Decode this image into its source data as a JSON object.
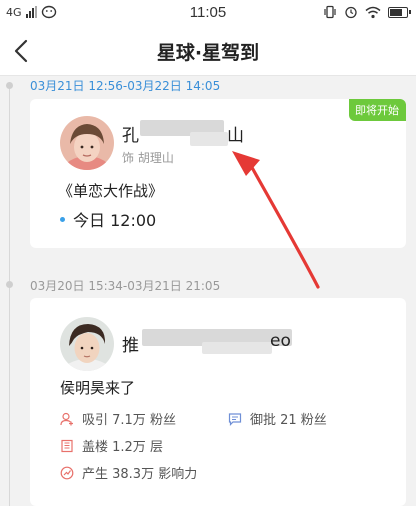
{
  "statusbar": {
    "network": "4G",
    "time": "11:05"
  },
  "navbar": {
    "title": "星球·星驾到"
  },
  "events": [
    {
      "daterange": "03月21日 12:56-03月22日 14:05",
      "daterange_color": "#3a8fd8",
      "badge": "即将开始",
      "name_prefix": "孔",
      "name_suffix": "山",
      "role": "饰 胡理山",
      "work": "《单恋大作战》",
      "time": "今日 12:00"
    },
    {
      "daterange": "03月20日 15:34-03月21日 21:05",
      "daterange_color": "#999999",
      "name_prefix": "推",
      "name_suffix": "eo",
      "title": "侯明昊来了",
      "stats": {
        "attract": "吸引 7.1万 粉丝",
        "approve": "御批 21 粉丝",
        "floors": "盖楼 1.2万 层",
        "influence": "产生 38.3万 影响力"
      }
    }
  ],
  "colors": {
    "accent_blue": "#3a8fd8",
    "badge_green": "#6dc93c",
    "icon_red": "#e8716b",
    "icon_blue": "#6f8fd6",
    "arrow_red": "#e53935"
  },
  "icons": [
    "wechat-icon",
    "vibrate-icon",
    "alarm-icon",
    "wifi-icon",
    "battery-icon",
    "back-chevron-icon",
    "user-plus-icon",
    "chat-icon",
    "building-icon",
    "chart-icon"
  ]
}
